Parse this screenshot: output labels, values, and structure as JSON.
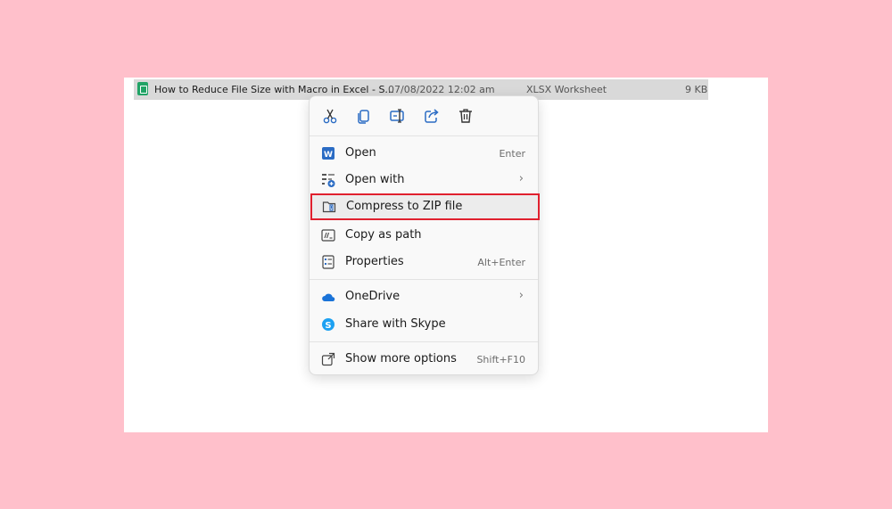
{
  "file_row": {
    "name": "How to Reduce File Size with Macro in Excel - S...",
    "date": "07/08/2022 12:02 am",
    "type": "XLSX Worksheet",
    "size": "9 KB"
  },
  "quick_actions": [
    {
      "name": "cut",
      "icon": "scissors-icon"
    },
    {
      "name": "copy",
      "icon": "copy-icon"
    },
    {
      "name": "rename",
      "icon": "rename-icon"
    },
    {
      "name": "share",
      "icon": "share-icon"
    },
    {
      "name": "delete",
      "icon": "trash-icon"
    }
  ],
  "menu": {
    "items": [
      {
        "label": "Open",
        "shortcut": "Enter",
        "icon": "word-icon"
      },
      {
        "label": "Open with",
        "icon": "open-with-icon",
        "submenu": true
      },
      {
        "label": "Compress to ZIP file",
        "icon": "zip-folder-icon",
        "highlighted": true
      },
      {
        "label": "Copy as path",
        "icon": "copy-path-icon"
      },
      {
        "label": "Properties",
        "shortcut": "Alt+Enter",
        "icon": "properties-icon"
      },
      {
        "label": "OneDrive",
        "icon": "onedrive-icon",
        "submenu": true
      },
      {
        "label": "Share with Skype",
        "icon": "skype-icon"
      },
      {
        "label": "Show more options",
        "shortcut": "Shift+F10",
        "icon": "more-options-icon"
      }
    ],
    "chevron": "›"
  },
  "colors": {
    "background": "#ffc0cb",
    "highlight_border": "#e0202e",
    "accent_blue": "#2b6cc4",
    "excel_green": "#21a366"
  }
}
